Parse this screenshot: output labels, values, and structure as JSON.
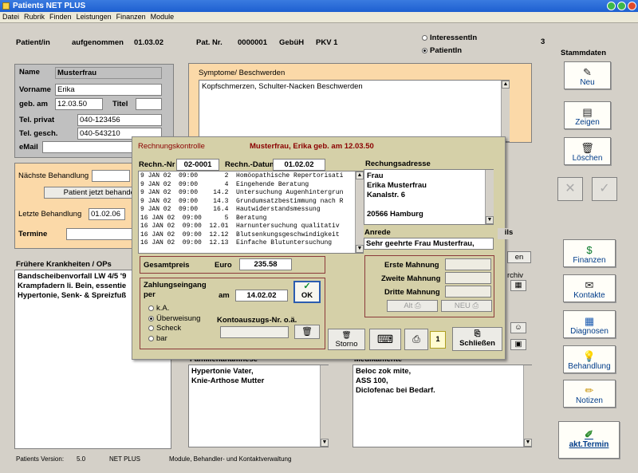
{
  "window": {
    "title": "Patients NET PLUS"
  },
  "menu": [
    "Datei",
    "Rubrik",
    "Finden",
    "Leistungen",
    "Finanzen",
    "Module"
  ],
  "header": {
    "patient_label": "Patient/in",
    "aufgenommen_label": "aufgenommen",
    "aufgenommen_value": "01.03.02",
    "patnr_label": "Pat. Nr.",
    "patnr_value": "0000001",
    "gebueh_label": "GebüH",
    "gebueh_value": "PKV 1",
    "radio_interessent": "InteressentIn",
    "radio_patient": "PatientIn",
    "count": "3"
  },
  "patient": {
    "name_label": "Name",
    "name_value": "Musterfrau",
    "vorname_label": "Vorname",
    "vorname_value": "Erika",
    "gebam_label": "geb. am",
    "gebam_value": "12.03.50",
    "titel_label": "Titel",
    "telprivat_label": "Tel. privat",
    "telprivat_value": "040-123456",
    "telgesch_label": "Tel. gesch.",
    "telgesch_value": "040-543210",
    "email_label": "eMail"
  },
  "behandlung": {
    "naechste_label": "Nächste Behandlung",
    "jetzt_button": "Patient jetzt behandeln",
    "letzte_label": "Letzte Behandlung",
    "letzte_value": "01.02.06",
    "termine_label": "Termine"
  },
  "symptome": {
    "title": "Symptome/ Beschwerden",
    "text": "Kopfschmerzen, Schulter-Nacken Beschwerden"
  },
  "krankheiten": {
    "title": "Frühere Krankheiten / OPs",
    "text": "Bandscheibenvorfall LW 4/5 '9\nKrampfadern li. Bein, essentie\nHypertonie, Senk- & Spreizfuß"
  },
  "familien": {
    "title": "Familienanamnese",
    "text": "Hypertonie Vater,\nKnie-Arthose Mutter"
  },
  "medikamente": {
    "title": "Medikamente",
    "text": "Beloc zok mite,\nASS 100,\nDiclofenac bei Bedarf."
  },
  "sidebar": {
    "title": "Stammdaten",
    "neu": "Neu",
    "zeigen": "Zeigen",
    "loeschen": "Löschen",
    "finanzen": "Finanzen",
    "kontakte": "Kontakte",
    "diagnosen": "Diagnosen",
    "behandlung": "Behandlung",
    "notizen": "Notizen",
    "akttermin": "akt.Termin"
  },
  "hidden_fragments": {
    "en": "en",
    "archiv": "rchiv",
    "ils": "ils"
  },
  "footer": {
    "version_label": "Patients Version:",
    "version": "5.0",
    "edition": "NET PLUS",
    "module": "Module, Behandler- und Kontaktverwaltung"
  },
  "dialog": {
    "title": "Rechnungskontrolle",
    "patient_line": "Musterfrau, Erika  geb. am 12.03.50",
    "rechnr_label": "Rechn.-Nr",
    "rechnr_value": "02-0001",
    "datum_label": "Rechn.-Datum",
    "datum_value": "01.02.02",
    "positions": [
      "9 JAN 02  09:00       2  Homöopathische Repertorisati",
      "9 JAN 02  09:00       4  Eingehende Beratung",
      "9 JAN 02  09:00    14.2  Untersuchung Augenhintergrun",
      "9 JAN 02  09:00    14.3  Grundumsatzbestimmung nach R",
      "9 JAN 02  09:00    16.4  Hautwiderstandsmessung",
      "16 JAN 02  09:00      5  Beratung",
      "16 JAN 02  09:00  12.01  Harnuntersuchung qualitativ",
      "16 JAN 02  09:00  12.12  Blutsenkungsgeschwindigkeit",
      "16 JAN 02  09:00  12.13  Einfache Blutuntersuchung"
    ],
    "gesamt_label": "Gesamtpreis",
    "euro_label": "Euro",
    "gesamt_value": "235.58",
    "zahlung_label": "Zahlungseingang\nper",
    "am_label": "am",
    "am_value": "14.02.02",
    "ok_label": "OK",
    "zahlung_options": [
      "k.A.",
      "Überweisung",
      "Scheck",
      "bar"
    ],
    "zahlung_selected": 1,
    "konto_label": "Kontoauszugs-Nr. o.ä.",
    "adresse_label": "Rechungsadresse",
    "adresse": "Frau\nErika Musterfrau\nKanalstr. 6\n\n20566 Hamburg",
    "anrede_label": "Anrede",
    "anrede_value": "Sehr geehrte Frau Musterfrau,",
    "mahnung1": "Erste Mahnung",
    "mahnung2": "Zweite Mahnung",
    "mahnung3": "Dritte Mahnung",
    "alt_label": "Alt",
    "neu_label": "NEU",
    "storno_label": "Storno",
    "copies": "1",
    "schliessen_label": "Schließen"
  }
}
